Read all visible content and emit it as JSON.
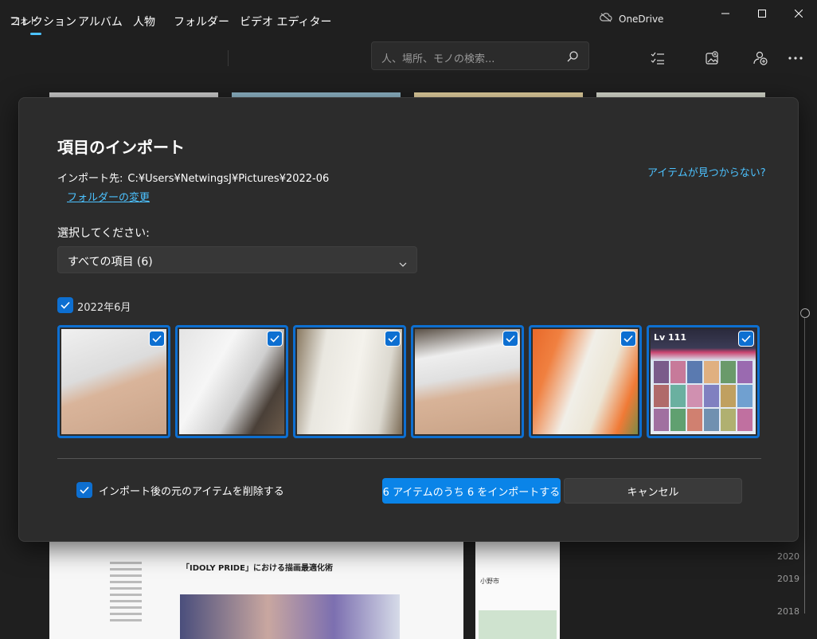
{
  "app": {
    "title": "フォト",
    "onedrive_label": "OneDrive"
  },
  "nav": {
    "tabs": [
      "コレクション",
      "アルバム",
      "人物",
      "フォルダー",
      "ビデオ エディター"
    ],
    "active_tab": 0
  },
  "search": {
    "placeholder": "人、場所、モノの検索..."
  },
  "toolbar": {
    "icons": [
      "select-list-icon",
      "image-import-icon",
      "add-person-icon",
      "more-icon"
    ]
  },
  "background": {
    "article_title": "「IDOLY PRIDE」における描画最適化術",
    "map_place": "小野市",
    "years": [
      "2020",
      "2019",
      "2018"
    ]
  },
  "dialog": {
    "title": "項目のインポート",
    "destination_label": "インポート先:",
    "destination_path": "C:¥Users¥NetwingsJ¥Pictures¥2022-06",
    "change_folder_link": "フォルダーの変更",
    "help_link": "アイテムが見つからない?",
    "select_label": "選択してください:",
    "dropdown_value": "すべての項目 (6)",
    "group": {
      "label": "2022年6月",
      "checked": true
    },
    "thumbnails": [
      {
        "name": "photo-1",
        "checked": true
      },
      {
        "name": "photo-2",
        "checked": true
      },
      {
        "name": "photo-3",
        "checked": true
      },
      {
        "name": "photo-4",
        "checked": true
      },
      {
        "name": "photo-5",
        "checked": true
      },
      {
        "name": "photo-6",
        "checked": true,
        "overlay_text": "Lv 111"
      }
    ],
    "delete_after_import": {
      "label": "インポート後の元のアイテムを削除する",
      "checked": true
    },
    "import_button": "6 アイテムのうち 6 をインポートする",
    "cancel_button": "キャンセル"
  },
  "colors": {
    "accent": "#0a84e8",
    "link": "#4cc2ff",
    "dialog_bg": "#2c2c2c",
    "app_bg": "#1f1f1f"
  }
}
